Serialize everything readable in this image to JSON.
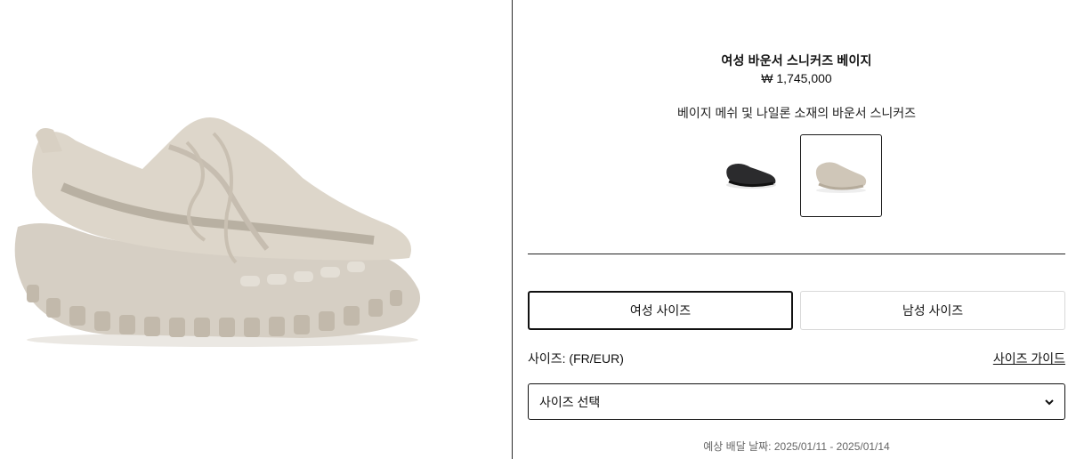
{
  "product": {
    "title": "여성 바운서 스니커즈 베이지",
    "price": "₩ 1,745,000",
    "description": "베이지 메쉬 및 나일론 소재의 바운서 스니커즈"
  },
  "variants": [
    {
      "color": "#2b2b2d",
      "name": "black-variant"
    },
    {
      "color": "#cfc6b8",
      "name": "beige-variant",
      "selected": true
    }
  ],
  "size_tabs": {
    "women": "여성 사이즈",
    "men": "남성 사이즈"
  },
  "size": {
    "label": "사이즈: (FR/EUR)",
    "guide": "사이즈 가이드",
    "select_placeholder": "사이즈 선택"
  },
  "delivery": "예상 배달 날짜: 2025/01/11 - 2025/01/14"
}
